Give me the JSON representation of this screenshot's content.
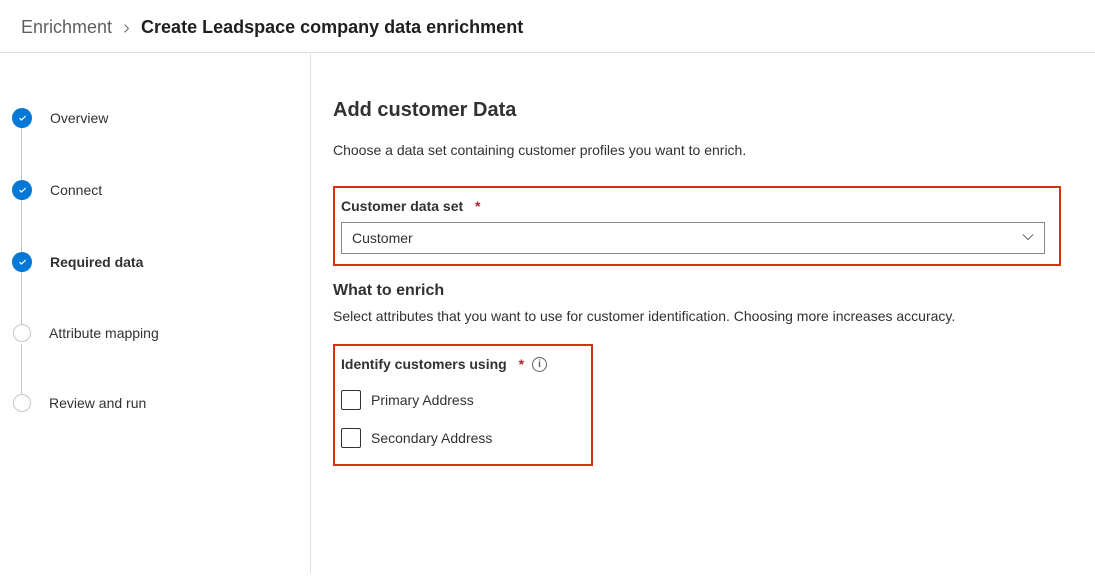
{
  "breadcrumb": {
    "parent": "Enrichment",
    "current": "Create Leadspace company data enrichment"
  },
  "sidebar": {
    "items": [
      {
        "label": "Overview",
        "state": "done"
      },
      {
        "label": "Connect",
        "state": "done"
      },
      {
        "label": "Required data",
        "state": "current"
      },
      {
        "label": "Attribute mapping",
        "state": "pending"
      },
      {
        "label": "Review and run",
        "state": "pending"
      }
    ]
  },
  "main": {
    "title": "Add customer Data",
    "description": "Choose a data set containing customer profiles you want to enrich.",
    "dataset": {
      "label": "Customer data set",
      "value": "Customer"
    },
    "enrich": {
      "title": "What to enrich",
      "description": "Select attributes that you want to use for customer identification. Choosing more increases accuracy.",
      "identify_label": "Identify customers using",
      "options": [
        {
          "label": "Primary Address"
        },
        {
          "label": "Secondary Address"
        }
      ]
    }
  }
}
